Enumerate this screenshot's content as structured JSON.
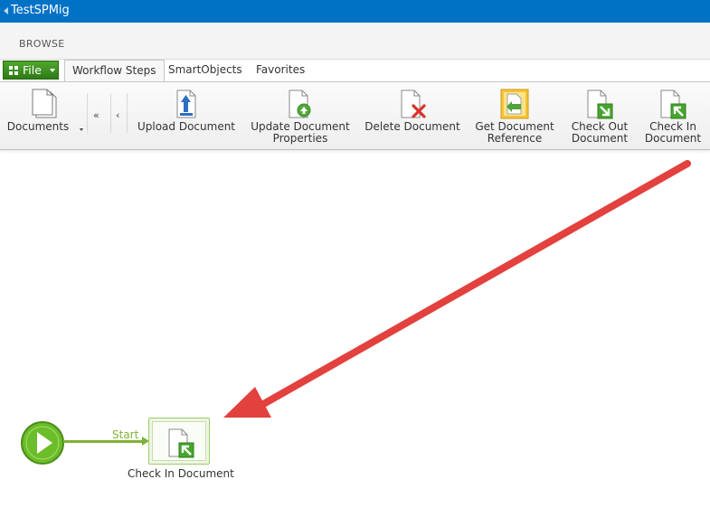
{
  "window": {
    "title": "TestSPMig"
  },
  "top_tabs": {
    "browse": "BROWSE"
  },
  "ribbon_tabs": {
    "file": "File",
    "items": [
      "Workflow Steps",
      "SmartObjects",
      "Favorites"
    ]
  },
  "ribbon": {
    "documents_label": "Documents",
    "nav_first": "«",
    "nav_prev": "‹",
    "buttons": [
      {
        "line1": "Upload Document",
        "line2": ""
      },
      {
        "line1": "Update Document",
        "line2": "Properties"
      },
      {
        "line1": "Delete Document",
        "line2": ""
      },
      {
        "line1": "Get Document",
        "line2": "Reference"
      },
      {
        "line1": "Check Out",
        "line2": "Document"
      },
      {
        "line1": "Check In",
        "line2": "Document"
      }
    ]
  },
  "canvas": {
    "connector_label": "Start",
    "step_label": "Check In Document"
  },
  "colors": {
    "title_bar": "#0072c6",
    "file_button": "#3a8a1e",
    "connector": "#7fb335",
    "start_node": "#6bbd2a",
    "annotation_arrow": "#e2413e"
  }
}
